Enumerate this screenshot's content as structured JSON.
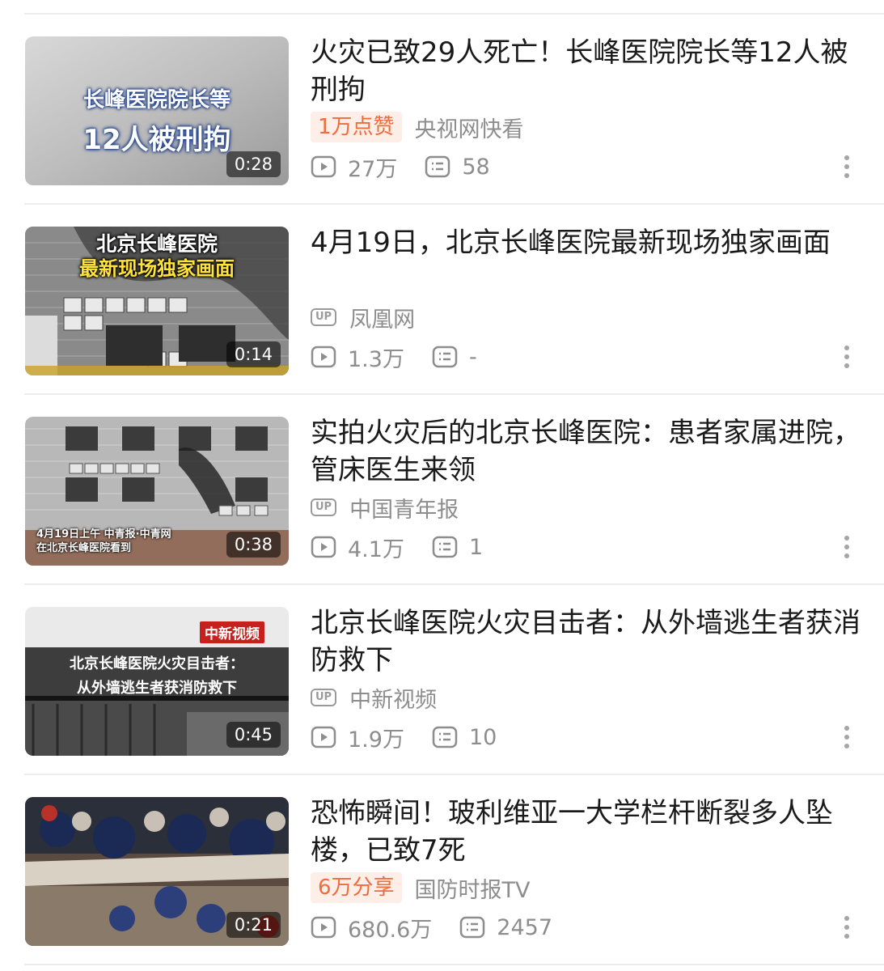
{
  "items": [
    {
      "title": "火灾已致29人死亡！长峰医院院长等12人被刑拘",
      "badge": "1万点赞",
      "source": "央视网快看",
      "has_up": false,
      "views": "27万",
      "comments": "58",
      "duration": "0:28",
      "thumb_text": [
        "长峰医院院长等",
        "12人被刑拘"
      ]
    },
    {
      "title": "4月19日，北京长峰医院最新现场独家画面",
      "badge": "",
      "source": "凤凰网",
      "has_up": true,
      "views": "1.3万",
      "comments": "-",
      "duration": "0:14",
      "thumb_text": [
        "北京长峰医院",
        "最新现场独家画面"
      ]
    },
    {
      "title": "实拍火灾后的北京长峰医院：患者家属进院，管床医生来领",
      "badge": "",
      "source": "中国青年报",
      "has_up": true,
      "views": "4.1万",
      "comments": "1",
      "duration": "0:38",
      "thumb_text": [
        "4月19日上午 中青报·中青网",
        "在北京长峰医院看到"
      ]
    },
    {
      "title": "北京长峰医院火灾目击者：从外墙逃生者获消防救下",
      "badge": "",
      "source": "中新视频",
      "has_up": true,
      "views": "1.9万",
      "comments": "10",
      "duration": "0:45",
      "thumb_text": [
        "北京长峰医院火灾目击者：",
        "从外墙逃生者获消防救下"
      ],
      "thumb_logo": "中新视频"
    },
    {
      "title": "恐怖瞬间！玻利维亚一大学栏杆断裂多人坠楼，已致7死",
      "badge": "6万分享",
      "source": "国防时报TV",
      "has_up": false,
      "views": "680.6万",
      "comments": "2457",
      "duration": "0:21",
      "thumb_text": []
    }
  ],
  "labels": {
    "up_tag": "UP"
  },
  "colors": {
    "badge_text": "#f26b3a",
    "badge_bg": "#fdeee8",
    "meta_text": "#8d8d8d",
    "title_text": "#1a1a1a"
  },
  "icons": {
    "views": "play-icon",
    "comments": "comment-icon",
    "more": "more-vertical-icon",
    "up": "up-tag-icon"
  }
}
